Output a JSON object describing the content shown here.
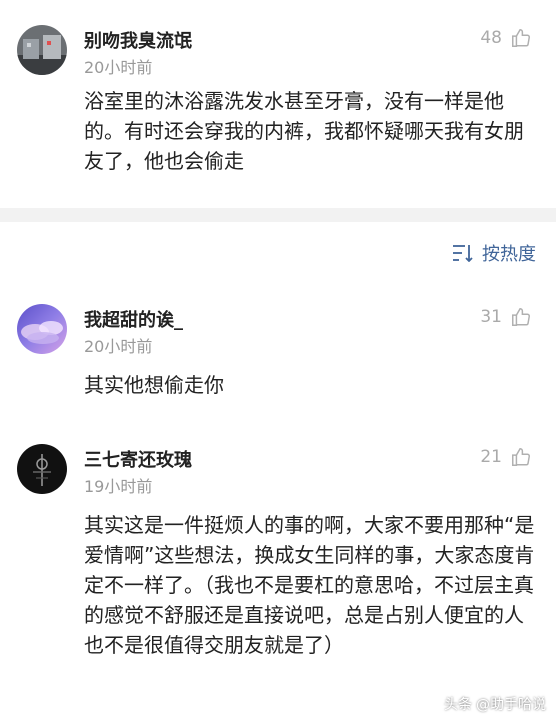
{
  "comments": [
    {
      "username": "别吻我臭流氓",
      "time": "20小时前",
      "likes": "48",
      "body": "浴室里的沐浴露洗发水甚至牙膏，没有一样是他的。有时还会穿我的内裤，我都怀疑哪天我有女朋友了，他也会偷走"
    },
    {
      "username": "我超甜的诶_",
      "time": "20小时前",
      "likes": "31",
      "body": "其实他想偷走你"
    },
    {
      "username": "三七寄还玫瑰",
      "time": "19小时前",
      "likes": "21",
      "body": "其实这是一件挺烦人的事的啊，大家不要用那种“是爱情啊”这些想法，换成女生同样的事，大家态度肯定不一样了。（我也不是要杠的意思哈，不过层主真的感觉不舒服还是直接说吧，总是占别人便宜的人也不是很值得交朋友就是了）"
    }
  ],
  "sort": {
    "label": "按热度",
    "icon": "sort-icon"
  },
  "watermark": {
    "left": "头条",
    "right": "@助手哈说"
  },
  "colors": {
    "link_blue": "#406599",
    "time_gray": "#999999",
    "separator": "#f2f2f2"
  }
}
